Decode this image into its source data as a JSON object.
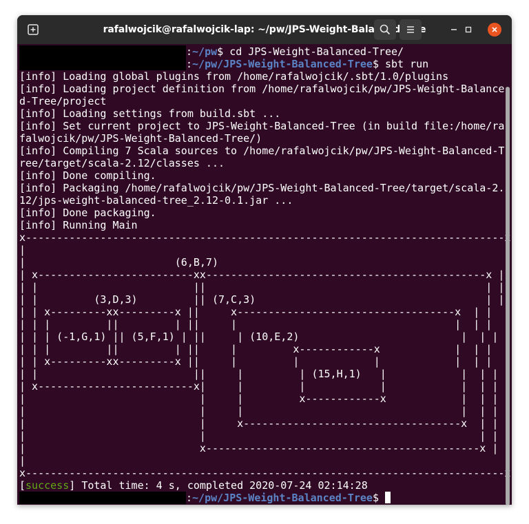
{
  "window": {
    "title": "rafalwojcik@rafalwojcik-lap: ~/pw/JPS-Weight-Balanced-Tree"
  },
  "icons": {
    "new_tab": "new-tab-icon",
    "search": "search-icon",
    "menu": "hamburger-menu-icon",
    "minimize": "minimize-icon",
    "maximize": "maximize-icon",
    "close": "close-icon"
  },
  "colors": {
    "terminal_bg": "#300a24",
    "titlebar_bg": "#2b2b2b",
    "prompt_path": "#5b84c7",
    "success": "#60a917",
    "close_button": "#e95420"
  },
  "prompt": {
    "cd": {
      "sep": ":",
      "path": "~/pw",
      "suffix": "$ ",
      "command": "cd JPS-Weight-Balanced-Tree/"
    },
    "run": {
      "sep": ":",
      "path": "~/pw/JPS-Weight-Balanced-Tree",
      "suffix": "$ ",
      "command": "sbt run"
    },
    "final": {
      "sep": ":",
      "path": "~/pw/JPS-Weight-Balanced-Tree",
      "suffix": "$ "
    }
  },
  "output": {
    "info_lines": [
      "[info] Loading global plugins from /home/rafalwojcik/.sbt/1.0/plugins",
      "[info] Loading project definition from /home/rafalwojcik/pw/JPS-Weight-Balance",
      "d-Tree/project",
      "[info] Loading settings from build.sbt ...",
      "[info] Set current project to JPS-Weight-Balanced-Tree (in build file:/home/ra",
      "falwojcik/pw/JPS-Weight-Balanced-Tree/)",
      "[info] Compiling 7 Scala sources to /home/rafalwojcik/pw/JPS-Weight-Balanced-T",
      "ree/target/scala-2.12/classes ...",
      "[info] Done compiling.",
      "[info] Packaging /home/rafalwojcik/pw/JPS-Weight-Balanced-Tree/target/scala-2.",
      "12/jps-weight-balanced-tree_2.12-0.1.jar ...",
      "[info] Done packaging.",
      "[info] Running Main"
    ],
    "tree_lines": [
      "x-----------------------------------------------------------------------------x",
      "|                                                                             |",
      "|                        (6,B,7)                                              |",
      "| x-------------------------xx---------------------------------------------x |",
      "| |                         ||                                             | |",
      "| |         (3,D,3)         || (7,C,3)                                     | |",
      "| | x---------xx---------x ||     x-----------------------------------x  | |",
      "| | |         ||         | ||     |                                   |  | |",
      "| | | (-1,G,1) || (5,F,1) | ||     | (10,E,2)                          |  | |",
      "| | |         ||         | ||     |         x------------x            |  | |",
      "| | x---------xx---------x ||     |         |            |            |  | |",
      "| |                         ||     |         | (15,H,1)   |            |  | |",
      "| x-------------------------x|     |         |            |            |  | |",
      "|                            |     |         x------------x            |  | |",
      "|                            |     |                                   |  | |",
      "|                            |     x-----------------------------------x  | |",
      "|                            |                                            | |",
      "|                            x--------------------------------------------x |",
      "|                                                                             |",
      "x-----------------------------------------------------------------------------x"
    ],
    "success_tag": "success",
    "success_text": "Total time: 4 s, completed 2020-07-24 02:14:28"
  }
}
